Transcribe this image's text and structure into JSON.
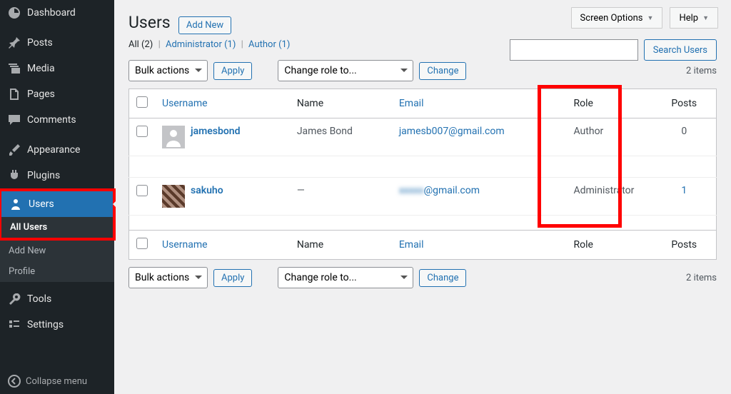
{
  "sidebar": {
    "dashboard": "Dashboard",
    "posts": "Posts",
    "media": "Media",
    "pages": "Pages",
    "comments": "Comments",
    "appearance": "Appearance",
    "plugins": "Plugins",
    "users": "Users",
    "tools": "Tools",
    "settings": "Settings",
    "collapse": "Collapse menu",
    "submenu": {
      "all": "All Users",
      "add": "Add New",
      "profile": "Profile"
    }
  },
  "topbar": {
    "screen_options": "Screen Options",
    "help": "Help"
  },
  "page": {
    "title": "Users",
    "add_new": "Add New"
  },
  "filters": {
    "all": "All",
    "all_count": "(2)",
    "admin": "Administrator",
    "admin_count": "(1)",
    "author": "Author",
    "author_count": "(1)"
  },
  "search": {
    "button": "Search Users"
  },
  "bulk": {
    "bulk_label": "Bulk actions",
    "apply": "Apply",
    "role_label": "Change role to...",
    "change": "Change",
    "items": "2 items"
  },
  "columns": {
    "username": "Username",
    "name": "Name",
    "email": "Email",
    "role": "Role",
    "posts": "Posts"
  },
  "rows": [
    {
      "username": "jamesbond",
      "name": "James Bond",
      "email": "jamesb007@gmail.com",
      "email_display": "jamesb007@gmail.com",
      "role": "Author",
      "posts": "0",
      "avatar": "default"
    },
    {
      "username": "sakuho",
      "name": "—",
      "email": "@gmail.com",
      "email_prefix_blurred": "xxxxx",
      "role": "Administrator",
      "posts": "1",
      "avatar": "pix"
    }
  ]
}
